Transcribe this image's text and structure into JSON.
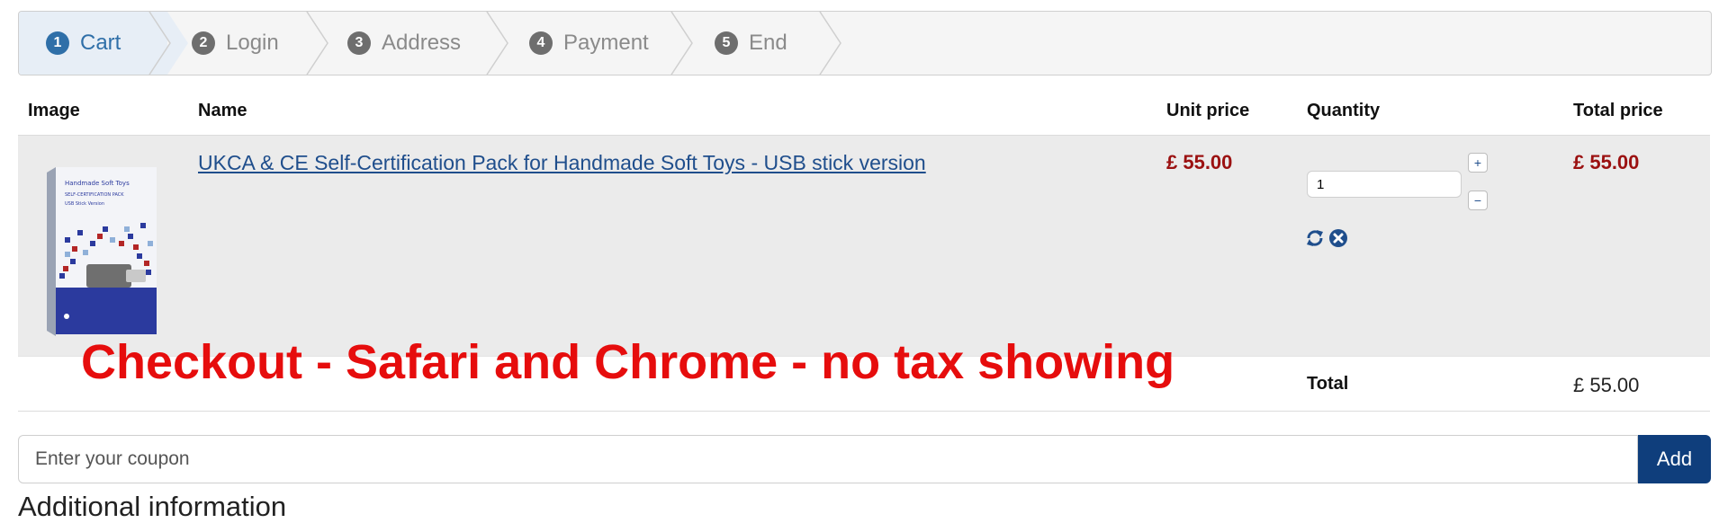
{
  "steps": [
    {
      "num": "1",
      "label": "Cart",
      "active": true
    },
    {
      "num": "2",
      "label": "Login",
      "active": false
    },
    {
      "num": "3",
      "label": "Address",
      "active": false
    },
    {
      "num": "4",
      "label": "Payment",
      "active": false
    },
    {
      "num": "5",
      "label": "End",
      "active": false
    }
  ],
  "table": {
    "headers": {
      "image": "Image",
      "name": "Name",
      "unit_price": "Unit price",
      "quantity": "Quantity",
      "total_price": "Total price"
    },
    "rows": [
      {
        "name": "UKCA & CE Self-Certification Pack for Handmade Soft Toys - USB stick version",
        "unit_price": "£ 55.00",
        "quantity": "1",
        "total_price": "£ 55.00",
        "image_text": {
          "title": "Handmade Soft Toys",
          "subtitle": "SELF-CERTIFICATION PACK",
          "version": "USB Stick Version"
        }
      }
    ],
    "qty_plus": "+",
    "qty_minus": "−"
  },
  "totals": {
    "label": "Total",
    "value": "£ 55.00"
  },
  "overlay_caption": "Checkout - Safari and Chrome - no tax showing",
  "coupon": {
    "placeholder": "Enter your coupon",
    "button": "Add"
  },
  "additional_info": "Additional information",
  "colors": {
    "accent": "#2f6fa8",
    "price": "#9b1111",
    "button": "#0f3e7c",
    "caption": "#e60d0d"
  }
}
